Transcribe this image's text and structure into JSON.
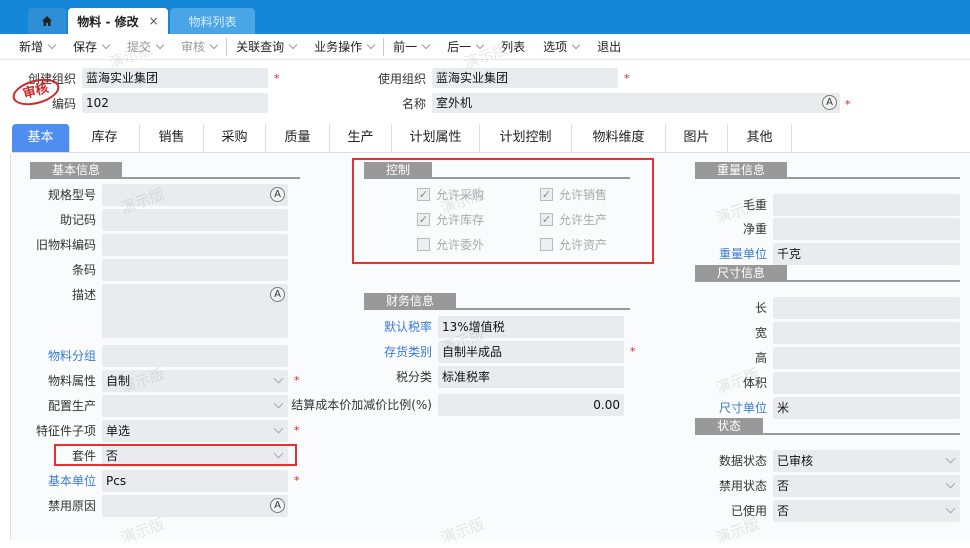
{
  "window_tabs": [
    {
      "label": "物料 - 修改",
      "active": true,
      "close": "×"
    },
    {
      "label": "物料列表",
      "active": false
    }
  ],
  "toolbar": [
    {
      "label": "新增",
      "chevron": true
    },
    {
      "label": "保存",
      "chevron": true
    },
    {
      "label": "提交",
      "chevron": true,
      "disabled": true
    },
    {
      "label": "审核",
      "chevron": true,
      "disabled": true
    },
    {
      "label": "关联查询",
      "chevron": true
    },
    {
      "label": "业务操作",
      "chevron": true
    },
    {
      "label": "前一",
      "chevron": true
    },
    {
      "label": "后一",
      "chevron": true
    },
    {
      "label": "列表"
    },
    {
      "label": "选项",
      "chevron": true
    },
    {
      "label": "退出"
    }
  ],
  "header": {
    "create_org_label": "创建组织",
    "create_org": "蓝海实业集团",
    "use_org_label": "使用组织",
    "use_org": "蓝海实业集团",
    "code_label": "编码",
    "code": "102",
    "name_label": "名称",
    "name": "室外机",
    "stamp": "审核"
  },
  "tabs": [
    "基本",
    "库存",
    "销售",
    "采购",
    "质量",
    "生产",
    "计划属性",
    "计划控制",
    "物料维度",
    "图片",
    "其他"
  ],
  "basic": {
    "title": "基本信息",
    "fields": [
      {
        "label": "规格型号",
        "value": ""
      },
      {
        "label": "助记码",
        "value": ""
      },
      {
        "label": "旧物料编码",
        "value": ""
      },
      {
        "label": "条码",
        "value": ""
      },
      {
        "label": "描述",
        "value": ""
      },
      {
        "label": "物料分组",
        "value": ""
      },
      {
        "label": "物料属性",
        "value": "自制"
      },
      {
        "label": "配置生产",
        "value": ""
      },
      {
        "label": "特征件子项",
        "value": "单选"
      },
      {
        "label": "套件",
        "value": "否"
      },
      {
        "label": "基本单位",
        "value": "Pcs"
      },
      {
        "label": "禁用原因",
        "value": ""
      }
    ]
  },
  "control": {
    "title": "控制",
    "items": [
      {
        "label": "允许采购",
        "checked": true
      },
      {
        "label": "允许销售",
        "checked": true
      },
      {
        "label": "允许库存",
        "checked": true
      },
      {
        "label": "允许生产",
        "checked": true
      },
      {
        "label": "允许委外",
        "checked": false
      },
      {
        "label": "允许资产",
        "checked": false
      }
    ]
  },
  "finance": {
    "title": "财务信息",
    "fields": [
      {
        "label": "默认税率",
        "value": "13%增值税"
      },
      {
        "label": "存货类别",
        "value": "自制半成品"
      },
      {
        "label": "税分类",
        "value": "标准税率"
      },
      {
        "label": "结算成本价加减价比例(%)",
        "value": "0.00"
      }
    ]
  },
  "weight": {
    "title": "重量信息",
    "fields": [
      {
        "label": "毛重",
        "value": ""
      },
      {
        "label": "净重",
        "value": ""
      },
      {
        "label": "重量单位",
        "value": "千克"
      }
    ]
  },
  "size": {
    "title": "尺寸信息",
    "fields": [
      {
        "label": "长",
        "value": ""
      },
      {
        "label": "宽",
        "value": ""
      },
      {
        "label": "高",
        "value": ""
      },
      {
        "label": "体积",
        "value": ""
      },
      {
        "label": "尺寸单位",
        "value": "米"
      }
    ]
  },
  "status": {
    "title": "状态",
    "fields": [
      {
        "label": "数据状态",
        "value": "已审核"
      },
      {
        "label": "禁用状态",
        "value": "否"
      },
      {
        "label": "已使用",
        "value": "否"
      }
    ]
  },
  "watermark": "演示版",
  "colors": {
    "topbar": "#1487d8",
    "active_tab": "#4f8ef0",
    "highlight": "#e83030",
    "link": "#3a7bd5"
  }
}
